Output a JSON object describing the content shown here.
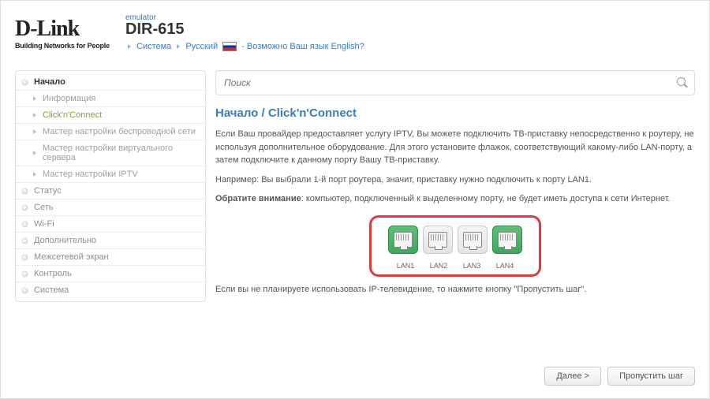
{
  "header": {
    "logo": {
      "brand": "D-Link",
      "tagline": "Building Networks for People"
    },
    "emulator": "emulator",
    "model": "DIR-615",
    "crumbs": {
      "item1": "Система",
      "item2": "Русский",
      "lang_hint": "- Возможно Ваш язык English?"
    }
  },
  "sidebar": {
    "start": "Начало",
    "children": {
      "info": "Информация",
      "cnc": "Click'n'Connect",
      "wifi_wizard": "Мастер настройки беспроводной сети",
      "vserver_wizard": "Мастер настройки виртуального сервера",
      "iptv_wizard": "Мастер настройки IPTV"
    },
    "status": "Статус",
    "net": "Сеть",
    "wifi": "Wi-Fi",
    "advanced": "Дополнительно",
    "firewall": "Межсетевой экран",
    "control": "Контроль",
    "system": "Система"
  },
  "search": {
    "placeholder": "Поиск"
  },
  "content": {
    "title": "Начало /  Click'n'Connect",
    "p1": "Если Ваш провайдер предоставляет услугу IPTV, Вы можете подключить ТВ-приставку непосредственно к роутеру, не используя дополнительное оборудование. Для этого установите флажок, соответствующий какому-либо LAN-порту, а затем подключите к данному порту Вашу ТВ-приставку.",
    "p2": "Например: Вы выбрали 1-й порт роутера, значит, приставку нужно подключить к порту LAN1.",
    "note_label": "Обратите внимание",
    "note_text": ": компьютер, подключенный к выделенному порту, не будет иметь доступа к сети Интернет.",
    "ports": [
      {
        "label": "LAN1",
        "selected": true
      },
      {
        "label": "LAN2",
        "selected": false
      },
      {
        "label": "LAN3",
        "selected": false
      },
      {
        "label": "LAN4",
        "selected": true
      }
    ],
    "p3": "Если вы не планируете использовать IP-телевидение, то нажмите кнопку \"Пропустить шаг\"."
  },
  "buttons": {
    "next": "Далее >",
    "skip": "Пропустить шаг"
  }
}
